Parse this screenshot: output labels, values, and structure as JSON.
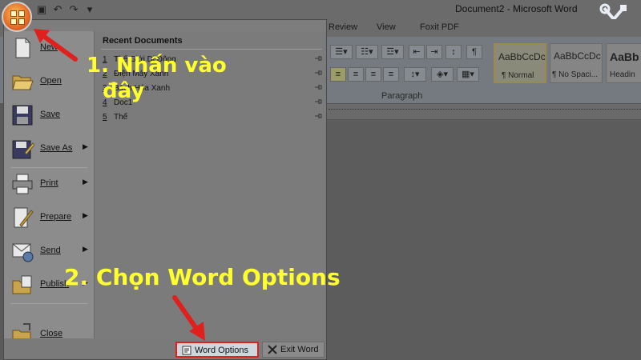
{
  "window": {
    "title": "Document2 - Microsoft Word"
  },
  "quick_access": {
    "icons": [
      "save-icon",
      "undo-icon",
      "redo-icon",
      "customize-icon"
    ]
  },
  "tabs": [
    "Review",
    "View",
    "Foxit PDF"
  ],
  "ribbon": {
    "paragraph_group_label": "Paragraph",
    "styles": [
      {
        "sample": "AaBbCcDc",
        "name": "¶ Normal"
      },
      {
        "sample": "AaBbCcDc",
        "name": "¶ No Spaci..."
      },
      {
        "sample": "AaBb",
        "name": "Headin"
      }
    ]
  },
  "office_menu": {
    "left_items": [
      {
        "label": "New",
        "icon": "new-document-icon",
        "has_arrow": false
      },
      {
        "label": "Open",
        "icon": "open-folder-icon",
        "has_arrow": false
      },
      {
        "label": "Save",
        "icon": "save-disk-icon",
        "has_arrow": false
      },
      {
        "label": "Save As",
        "icon": "save-as-icon",
        "has_arrow": true
      },
      {
        "label": "Print",
        "icon": "printer-icon",
        "has_arrow": true
      },
      {
        "label": "Prepare",
        "icon": "prepare-icon",
        "has_arrow": true
      },
      {
        "label": "Send",
        "icon": "send-icon",
        "has_arrow": true
      },
      {
        "label": "Publish",
        "icon": "publish-icon",
        "has_arrow": true
      },
      {
        "label": "Close",
        "icon": "close-document-icon",
        "has_arrow": false
      }
    ],
    "recent_documents": {
      "title": "Recent Documents",
      "items": [
        {
          "num": "1",
          "name": "Thế Giới Di Động"
        },
        {
          "num": "2",
          "name": "Điện Máy Xanh"
        },
        {
          "num": "3",
          "name": "Bách Hóa Xanh"
        },
        {
          "num": "4",
          "name": "Doc1"
        },
        {
          "num": "5",
          "name": "Thế"
        }
      ]
    },
    "word_options_label": "Word Options",
    "exit_word_label": "Exit Word"
  },
  "annotations": {
    "step1_line1": "1. Nhấn vào",
    "step1_line2": "đây",
    "step2": "2. Chọn Word Options",
    "color": "#ffff2e",
    "arrow_color": "#e0201c"
  }
}
